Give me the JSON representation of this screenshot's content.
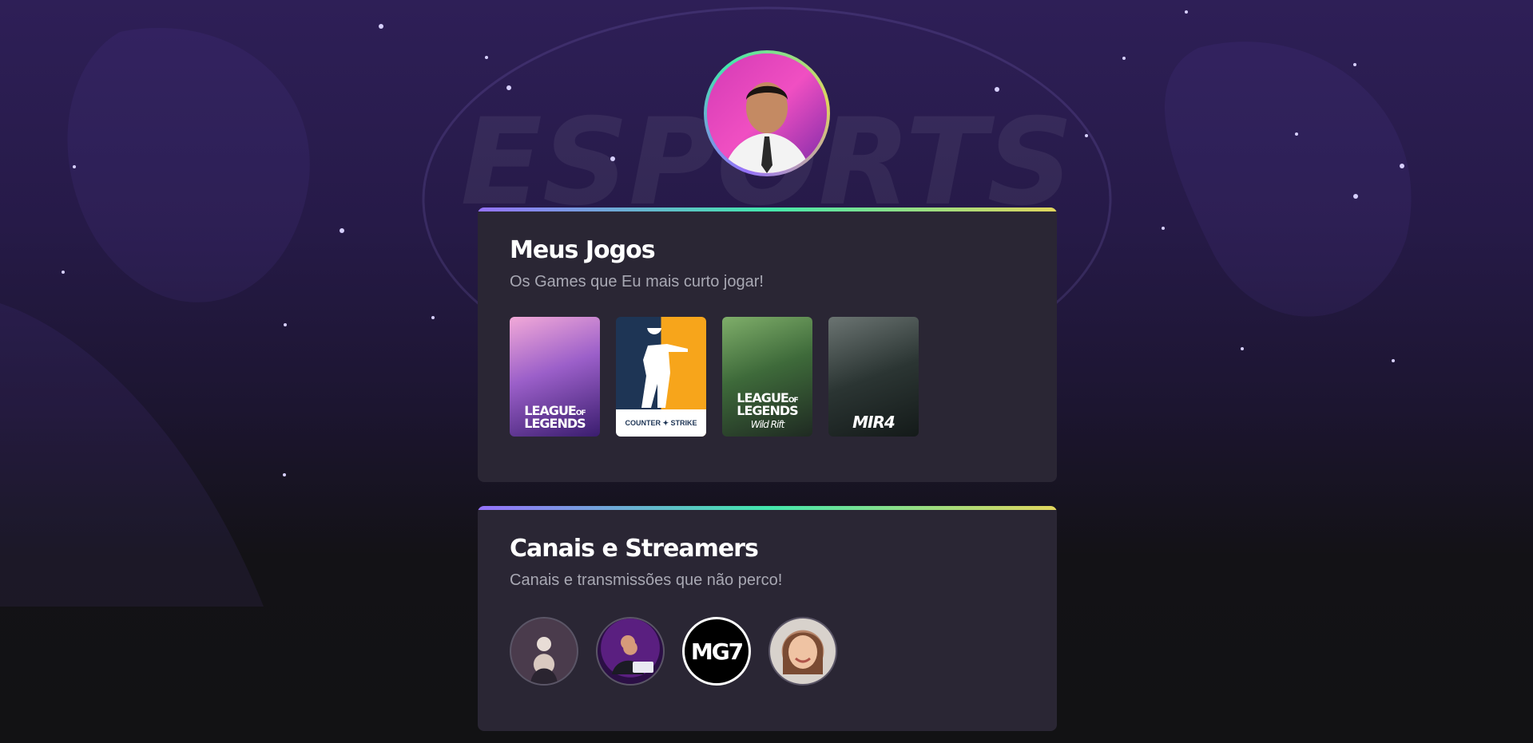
{
  "background": {
    "watermark_text": "ESPORTS",
    "colors": {
      "top": "#2e1f57",
      "bottom": "#121214"
    }
  },
  "profile": {
    "avatar_alt": "Foto de perfil",
    "ring_colors": [
      "#9572fc",
      "#43e7ad",
      "#e1d55d"
    ]
  },
  "games_section": {
    "title": "Meus Jogos",
    "subtitle": "Os Games que Eu mais curto jogar!",
    "games": [
      {
        "name": "LEAGUE OF LEGENDS",
        "icon": "league-of-legends-cover"
      },
      {
        "name": "COUNTER STRIKE",
        "icon": "counter-strike-cover"
      },
      {
        "name": "LEAGUE OF LEGENDS WILD RIFT",
        "icon": "wild-rift-cover"
      },
      {
        "name": "MIR4",
        "icon": "mir4-cover"
      }
    ]
  },
  "streamers_section": {
    "title": "Canais e Streamers",
    "subtitle": "Canais e transmissões que não perco!",
    "streamers": [
      {
        "icon": "streamer-avatar"
      },
      {
        "icon": "streamer-avatar"
      },
      {
        "label": "MG7",
        "icon": "mg7-logo"
      },
      {
        "icon": "streamer-avatar"
      }
    ]
  },
  "accent_gradient": [
    "#9572fc",
    "#43e7ad",
    "#e1d55d"
  ]
}
